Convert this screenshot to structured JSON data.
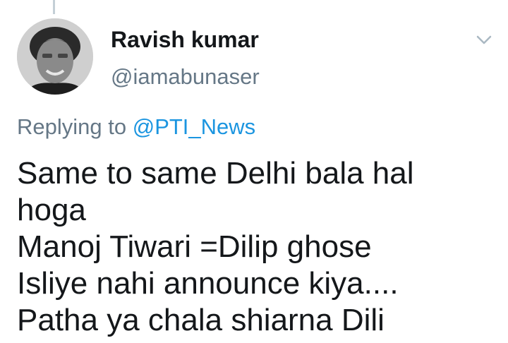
{
  "tweet": {
    "author_name": "Ravish kumar",
    "author_handle": "@iamabunaser",
    "replying_prefix": "Replying to ",
    "replying_to": "@PTI_News",
    "body": "Same to same Delhi bala hal\nhoga\nManoj Tiwari =Dilip ghose\nIsliye nahi announce kiya....\nPatha ya chala shiarna Dili"
  },
  "icons": {
    "avatar": "avatar-photo",
    "menu": "chevron-down-icon"
  },
  "colors": {
    "link": "#1b95e0",
    "secondary_text": "#657786",
    "primary_text": "#14171a"
  }
}
